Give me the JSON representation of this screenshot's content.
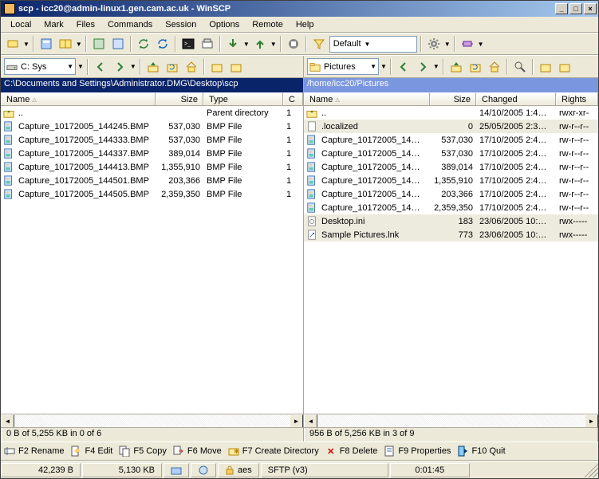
{
  "window": {
    "title": "scp - icc20@admin-linux1.gen.cam.ac.uk - WinSCP"
  },
  "menu": {
    "local": "Local",
    "mark": "Mark",
    "files": "Files",
    "commands": "Commands",
    "session": "Session",
    "options": "Options",
    "remote": "Remote",
    "help": "Help"
  },
  "main_toolbar": {
    "transfer_mode": "Default"
  },
  "left": {
    "drive_label": "C: Sys",
    "path": "C:\\Documents and Settings\\Administrator.DMG\\Desktop\\scp",
    "columns": {
      "name": "Name",
      "size": "Size",
      "type": "Type",
      "changed": "C"
    },
    "parent": {
      "name": "..",
      "type": "Parent directory",
      "changed": "1"
    },
    "rows": [
      {
        "name": "Capture_10172005_144245.BMP",
        "size": "537,030",
        "type": "BMP File",
        "changed": "1"
      },
      {
        "name": "Capture_10172005_144333.BMP",
        "size": "537,030",
        "type": "BMP File",
        "changed": "1"
      },
      {
        "name": "Capture_10172005_144337.BMP",
        "size": "389,014",
        "type": "BMP File",
        "changed": "1"
      },
      {
        "name": "Capture_10172005_144413.BMP",
        "size": "1,355,910",
        "type": "BMP File",
        "changed": "1"
      },
      {
        "name": "Capture_10172005_144501.BMP",
        "size": "203,366",
        "type": "BMP File",
        "changed": "1"
      },
      {
        "name": "Capture_10172005_144505.BMP",
        "size": "2,359,350",
        "type": "BMP File",
        "changed": "1"
      }
    ],
    "status": "0 B of 5,255 KB in 0 of 6"
  },
  "right": {
    "drive_label": "Pictures",
    "path": "/home/icc20/Pictures",
    "columns": {
      "name": "Name",
      "size": "Size",
      "changed": "Changed",
      "rights": "Rights"
    },
    "parent": {
      "name": "..",
      "changed": "14/10/2005 1:4…",
      "rights": "rwxr-xr-"
    },
    "rows": [
      {
        "name": ".localized",
        "size": "0",
        "changed": "25/05/2005 2:3…",
        "rights": "rw-r--r--",
        "sel": true
      },
      {
        "name": "Capture_10172005_14…",
        "size": "537,030",
        "changed": "17/10/2005 2:4…",
        "rights": "rw-r--r--"
      },
      {
        "name": "Capture_10172005_14…",
        "size": "537,030",
        "changed": "17/10/2005 2:4…",
        "rights": "rw-r--r--"
      },
      {
        "name": "Capture_10172005_14…",
        "size": "389,014",
        "changed": "17/10/2005 2:4…",
        "rights": "rw-r--r--"
      },
      {
        "name": "Capture_10172005_14…",
        "size": "1,355,910",
        "changed": "17/10/2005 2:4…",
        "rights": "rw-r--r--"
      },
      {
        "name": "Capture_10172005_14…",
        "size": "203,366",
        "changed": "17/10/2005 2:4…",
        "rights": "rw-r--r--"
      },
      {
        "name": "Capture_10172005_14…",
        "size": "2,359,350",
        "changed": "17/10/2005 2:4…",
        "rights": "rw-r--r--"
      },
      {
        "name": "Desktop.ini",
        "size": "183",
        "changed": "23/06/2005 10:…",
        "rights": "rwx-----",
        "sel": true,
        "icon": "ini"
      },
      {
        "name": "Sample Pictures.lnk",
        "size": "773",
        "changed": "23/06/2005 10:…",
        "rights": "rwx-----",
        "sel": true,
        "icon": "lnk"
      }
    ],
    "status": "956 B of 5,256 KB in 3 of 9"
  },
  "ops": {
    "rename": "F2 Rename",
    "edit": "F4 Edit",
    "copy": "F5 Copy",
    "move": "F6 Move",
    "mkdir": "F7 Create Directory",
    "delete": "F8 Delete",
    "props": "F9 Properties",
    "quit": "F10 Quit"
  },
  "status2": {
    "bytes": "42,239 B",
    "kb": "5,130 KB",
    "enc": "aes",
    "proto": "SFTP (v3)",
    "time": "0:01:45"
  }
}
